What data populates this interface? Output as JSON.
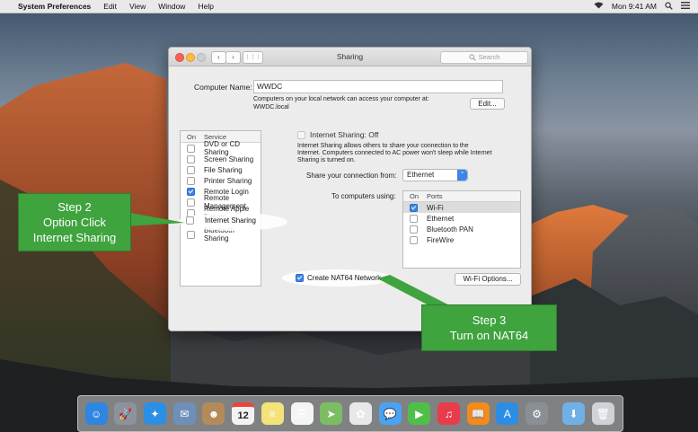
{
  "menubar": {
    "apple_icon": "",
    "app_name": "System Preferences",
    "menus": [
      "Edit",
      "View",
      "Window",
      "Help"
    ],
    "clock": "Mon 9:41 AM",
    "status_icons": [
      "wifi-icon",
      "search-icon",
      "list-icon"
    ]
  },
  "window": {
    "title": "Sharing",
    "search_placeholder": "Search",
    "back_glyph": "‹",
    "forward_glyph": "›",
    "grid_glyph": "⋮⋮⋮"
  },
  "computer_name": {
    "label": "Computer Name:",
    "value": "WWDC",
    "description": [
      "Computers on your local network can access your computer at:",
      "WWDC.local"
    ],
    "edit_button": "Edit..."
  },
  "service_list": {
    "col_on": "On",
    "col_service": "Service",
    "items": [
      {
        "label": "DVD or CD Sharing",
        "on": false
      },
      {
        "label": "Screen Sharing",
        "on": false
      },
      {
        "label": "File Sharing",
        "on": false
      },
      {
        "label": "Printer Sharing",
        "on": false
      },
      {
        "label": "Remote Login",
        "on": true
      },
      {
        "label": "Remote Management",
        "on": false
      },
      {
        "label": "Remote Apple Events",
        "on": false
      },
      {
        "label": "Internet Sharing",
        "on": false
      },
      {
        "label": "Bluetooth Sharing",
        "on": false
      }
    ]
  },
  "internet_sharing": {
    "status": "Internet Sharing: Off",
    "description": [
      "Internet Sharing allows others to share your connection to the",
      "Internet. Computers connected to AC power won't sleep while Internet",
      "Sharing is turned on."
    ],
    "share_from_label": "Share your connection from:",
    "share_from_value": "Ethernet",
    "to_computers_label": "To computers using:",
    "ports_col_on": "On",
    "ports_col_ports": "Ports",
    "ports": [
      {
        "label": "Wi-Fi",
        "on": true
      },
      {
        "label": "Ethernet",
        "on": false
      },
      {
        "label": "Bluetooth PAN",
        "on": false
      },
      {
        "label": "FireWire",
        "on": false
      }
    ],
    "nat64_label": "Create NAT64 Network",
    "nat64_checked": true,
    "wifi_options_button": "Wi-Fi Options..."
  },
  "callouts": {
    "step2": [
      "Step 2",
      "Option Click",
      "Internet Sharing"
    ],
    "step3": [
      "Step 3",
      "Turn on NAT64"
    ]
  },
  "dock": {
    "calendar_day": "12",
    "icons": [
      {
        "name": "finder-icon",
        "color": "#2f86e0",
        "glyph": "☺"
      },
      {
        "name": "launchpad-icon",
        "color": "#8c939c",
        "glyph": "🚀"
      },
      {
        "name": "safari-icon",
        "color": "#2b8fe5",
        "glyph": "✦"
      },
      {
        "name": "mail-stamp-icon",
        "color": "#6e90b8",
        "glyph": "✉"
      },
      {
        "name": "contacts-icon",
        "color": "#b48a5a",
        "glyph": "☻"
      },
      {
        "name": "calendar-icon",
        "color": "#f2f2f2",
        "glyph": "12"
      },
      {
        "name": "notes-icon",
        "color": "#f4e27a",
        "glyph": "≡"
      },
      {
        "name": "reminders-icon",
        "color": "#f5f5f5",
        "glyph": "☰"
      },
      {
        "name": "maps-icon",
        "color": "#7cbd63",
        "glyph": "➤"
      },
      {
        "name": "photos-icon",
        "color": "#e8e8e8",
        "glyph": "✿"
      },
      {
        "name": "messages-icon",
        "color": "#4aa3f2",
        "glyph": "💬"
      },
      {
        "name": "facetime-icon",
        "color": "#4fbf4a",
        "glyph": "▶"
      },
      {
        "name": "music-icon",
        "color": "#e83c4d",
        "glyph": "♫"
      },
      {
        "name": "ibooks-icon",
        "color": "#f08b1c",
        "glyph": "📖"
      },
      {
        "name": "app-store-icon",
        "color": "#2b8de4",
        "glyph": "A"
      },
      {
        "name": "system-preferences-icon",
        "color": "#8a8f96",
        "glyph": "⚙"
      },
      {
        "name": "downloads-folder-icon",
        "color": "#6fb0e6",
        "glyph": "⬇"
      },
      {
        "name": "trash-icon",
        "color": "#cfd3d8",
        "glyph": "🗑"
      }
    ]
  },
  "colors": {
    "callout_green": "#3fa33e",
    "checkbox_blue": "#3d85e8",
    "close": "#fc605b",
    "minimize": "#fdbc40",
    "zoom": "#34c84a"
  }
}
